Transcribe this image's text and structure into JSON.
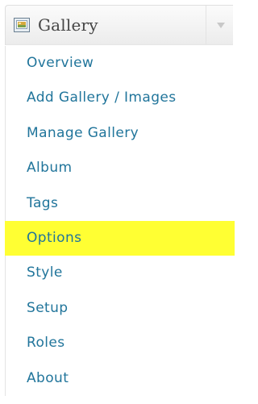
{
  "menu": {
    "title": "Gallery",
    "icon": "gallery-icon",
    "toggle_icon": "chevron-down-icon",
    "highlight_color": "#ffff33",
    "link_color": "#21759b",
    "items": [
      {
        "label": "Overview"
      },
      {
        "label": "Add Gallery / Images"
      },
      {
        "label": "Manage Gallery"
      },
      {
        "label": "Album"
      },
      {
        "label": "Tags"
      },
      {
        "label": "Options",
        "highlighted": true
      },
      {
        "label": "Style"
      },
      {
        "label": "Setup"
      },
      {
        "label": "Roles"
      },
      {
        "label": "About"
      }
    ]
  }
}
